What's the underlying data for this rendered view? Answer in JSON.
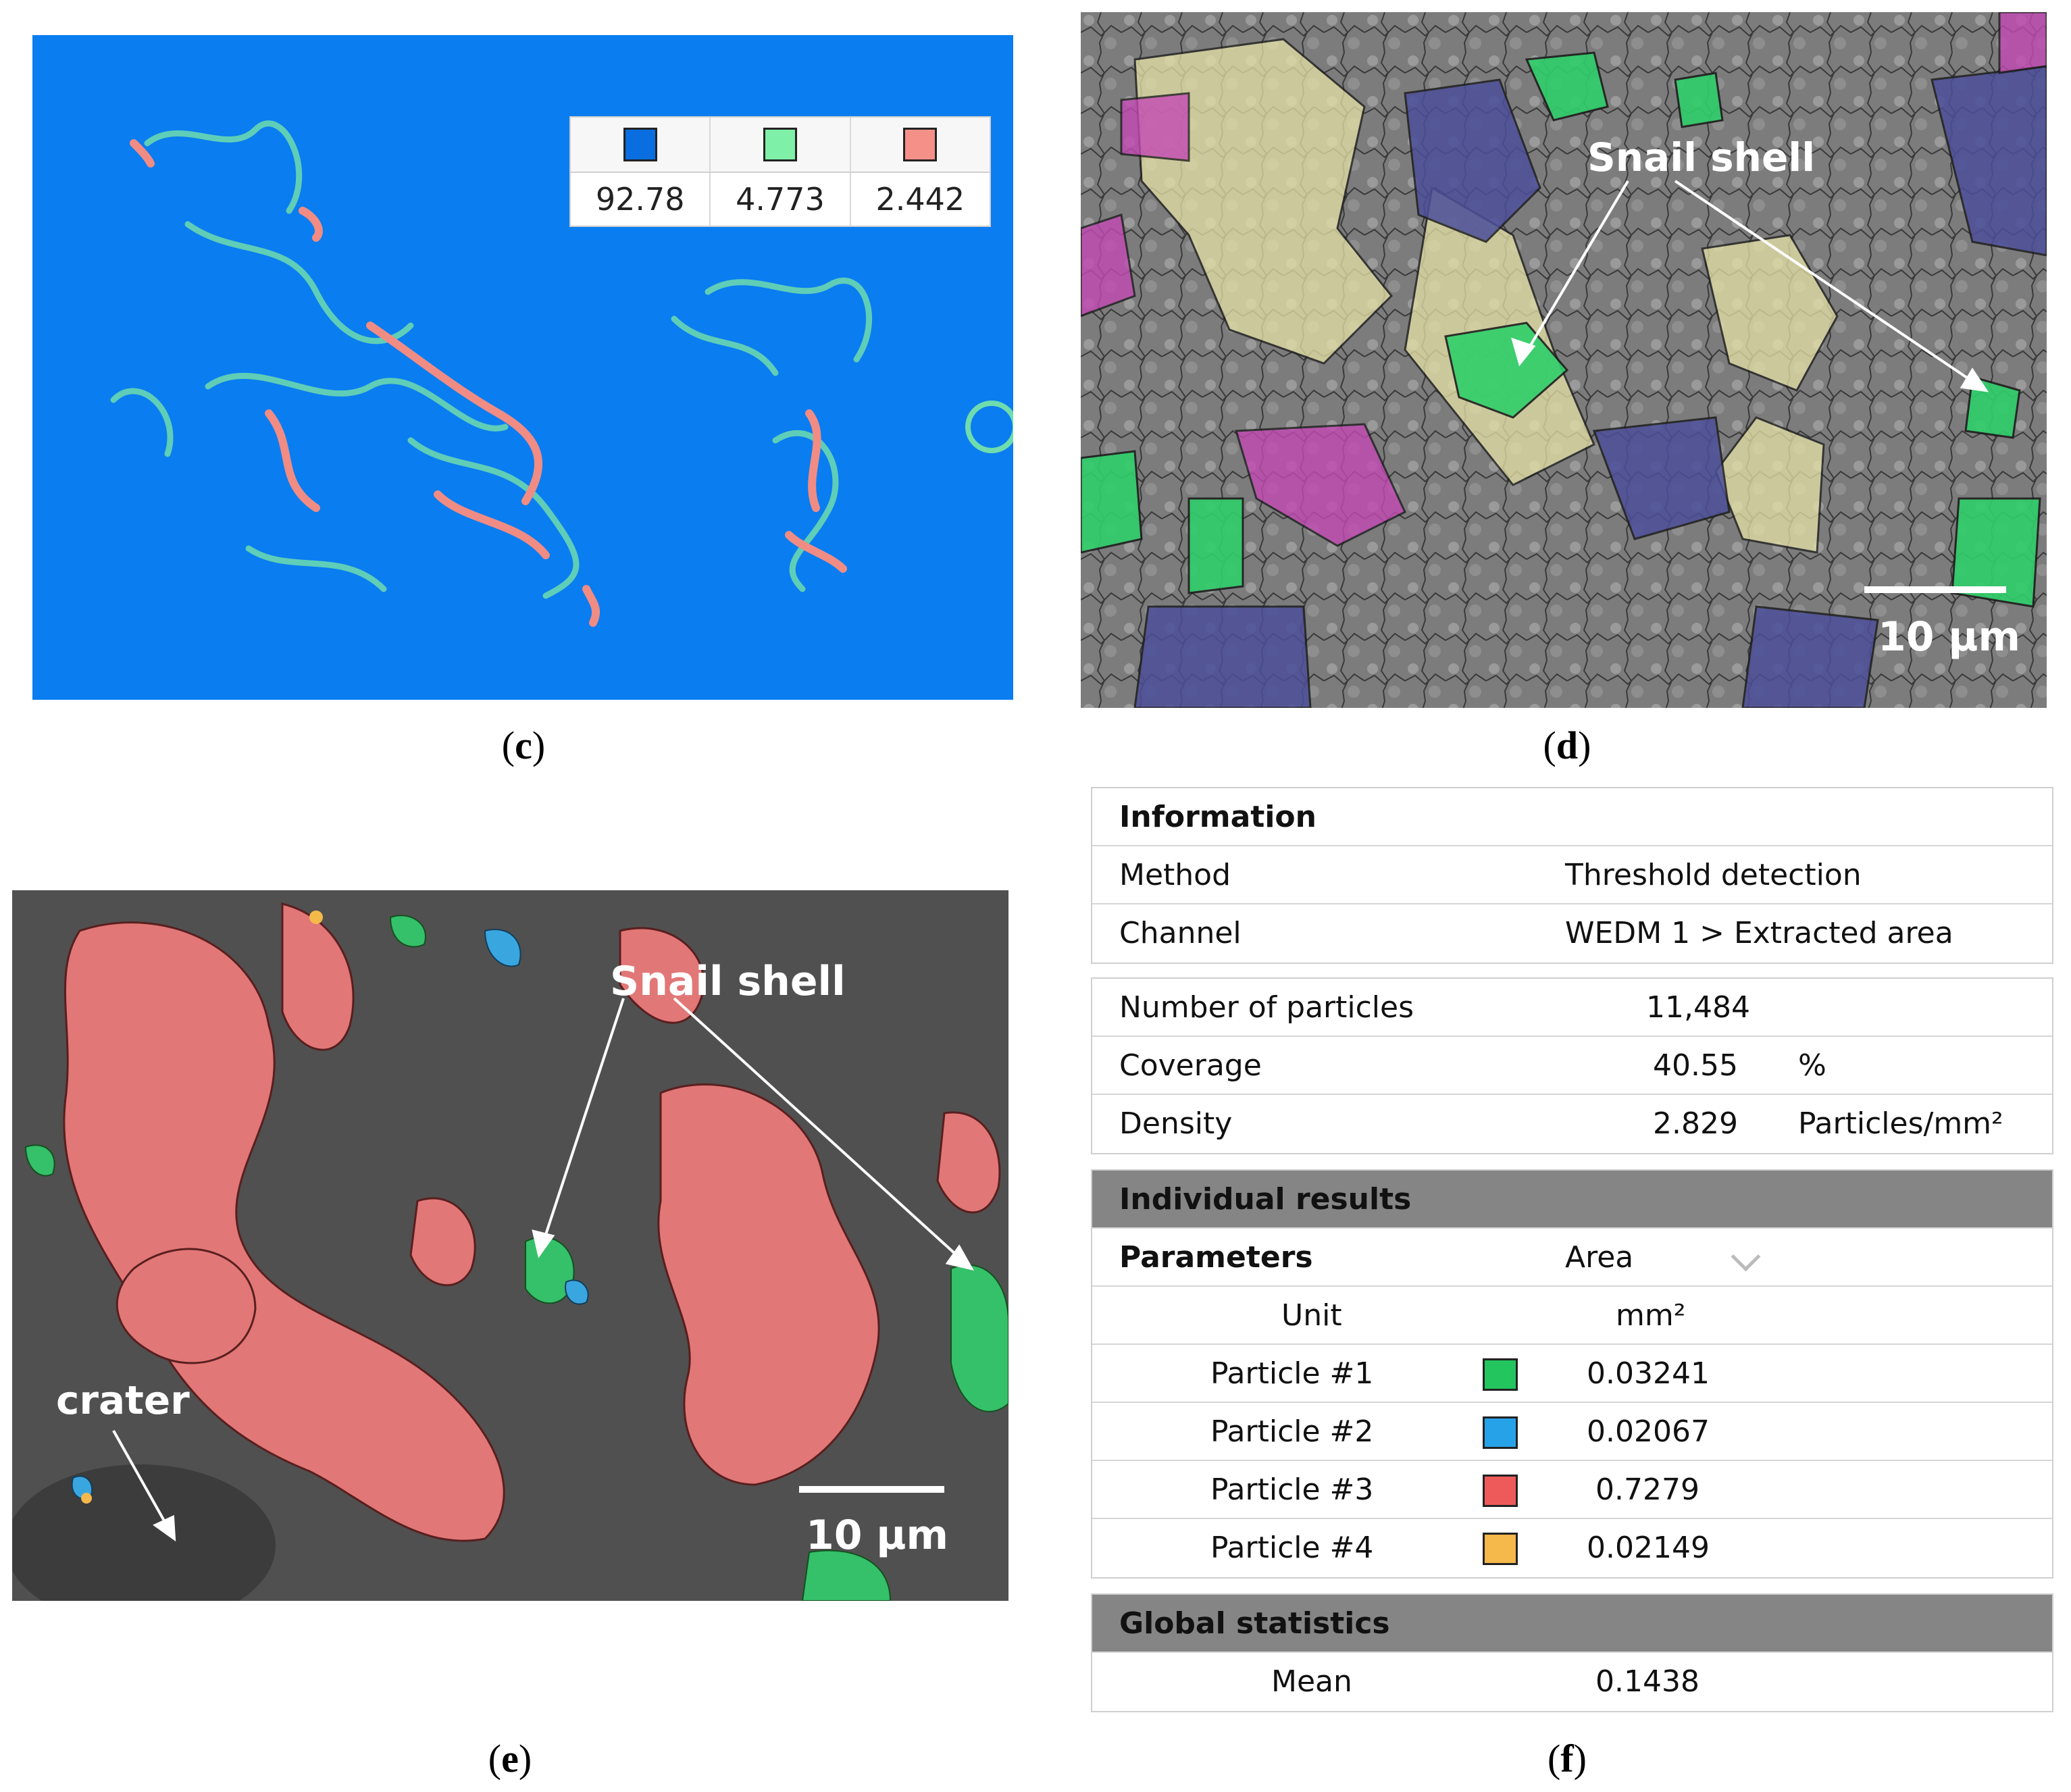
{
  "captions": {
    "c": "c",
    "d": "d",
    "e": "e",
    "f": "f"
  },
  "panel_c": {
    "legend": {
      "colors": [
        "#0a6ee0",
        "#7ff0a8",
        "#f59088"
      ],
      "values": [
        "92.78",
        "4.773",
        "2.442"
      ]
    }
  },
  "panel_d": {
    "annotation": "Snail shell",
    "scale_bar": "10 µm"
  },
  "panel_e": {
    "annotation_snail": "Snail shell",
    "annotation_crater": "crater",
    "scale_bar": "10 µm"
  },
  "panel_f": {
    "information": {
      "title": "Information",
      "method_label": "Method",
      "method_value": "Threshold detection",
      "channel_label": "Channel",
      "channel_value": "WEDM 1 > Extracted area"
    },
    "summary": {
      "particles_label": "Number of particles",
      "particles_value": "11,484",
      "coverage_label": "Coverage",
      "coverage_value": "40.55",
      "coverage_unit": "%",
      "density_label": "Density",
      "density_value": "2.829",
      "density_unit": "Particles/mm²"
    },
    "individual": {
      "title": "Individual results",
      "parameters_label": "Parameters",
      "parameters_value": "Area",
      "unit_label": "Unit",
      "unit_value": "mm²",
      "particles": [
        {
          "label": "Particle #1",
          "color": "#22c55e",
          "value": "0.03241"
        },
        {
          "label": "Particle #2",
          "color": "#26a3e8",
          "value": "0.02067"
        },
        {
          "label": "Particle #3",
          "color": "#ee5a5a",
          "value": "0.7279"
        },
        {
          "label": "Particle #4",
          "color": "#f5b84a",
          "value": "0.02149"
        }
      ]
    },
    "global": {
      "title": "Global statistics",
      "mean_label": "Mean",
      "mean_value": "0.1438"
    }
  }
}
